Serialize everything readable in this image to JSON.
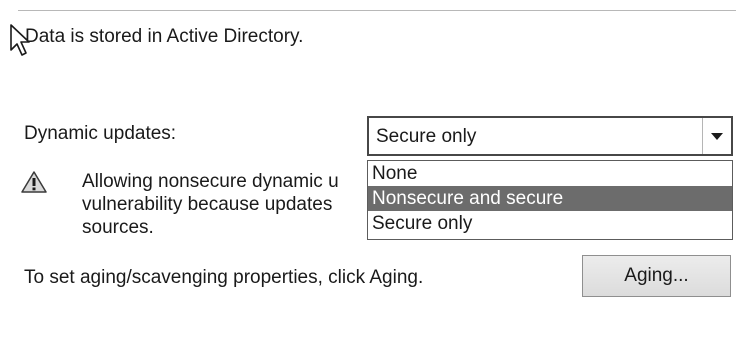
{
  "zone_properties": {
    "storage_info": "Data is stored in Active Directory.",
    "dynamic_updates": {
      "label": "Dynamic updates:",
      "selected_value": "Secure only",
      "options": [
        "None",
        "Nonsecure and secure",
        "Secure only"
      ],
      "highlighted_option": "Nonsecure and secure"
    },
    "warning": {
      "icon": "warning-icon",
      "line1": "Allowing nonsecure dynamic u",
      "line2": "vulnerability because updates",
      "line3": "sources."
    },
    "aging": {
      "text": "To set aging/scavenging properties, click Aging.",
      "button_label": "Aging..."
    }
  },
  "colors": {
    "highlight_bg": "#6c6c6c",
    "highlight_text": "#ffffff"
  }
}
